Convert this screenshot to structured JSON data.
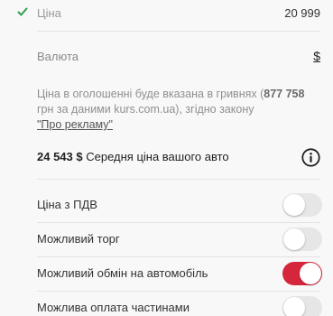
{
  "price": {
    "icon": "check-icon",
    "label": "Ціна",
    "value": "20 999"
  },
  "currency": {
    "label": "Валюта",
    "value": "$"
  },
  "info": {
    "text_before": "Ціна в оголошенні буде вказана в гривнях (",
    "uah_amount": "877 758",
    "text_middle": "грн за даними kurs.com.ua), згідно закону ",
    "link": "\"Про рекламу\""
  },
  "average": {
    "value": "24 543 $",
    "label": "Середня ціна вашого авто",
    "icon": "info-icon"
  },
  "options": [
    {
      "label": "Ціна з ПДВ",
      "enabled": false
    },
    {
      "label": "Можливий торг",
      "enabled": false
    },
    {
      "label": "Можливий обмін на автомобіль",
      "enabled": true
    },
    {
      "label": "Можлива оплата частинами",
      "enabled": false
    }
  ],
  "colors": {
    "accent": "#d6263b",
    "check": "#2e9e4f",
    "toggle_off": "#e6e6e6"
  }
}
